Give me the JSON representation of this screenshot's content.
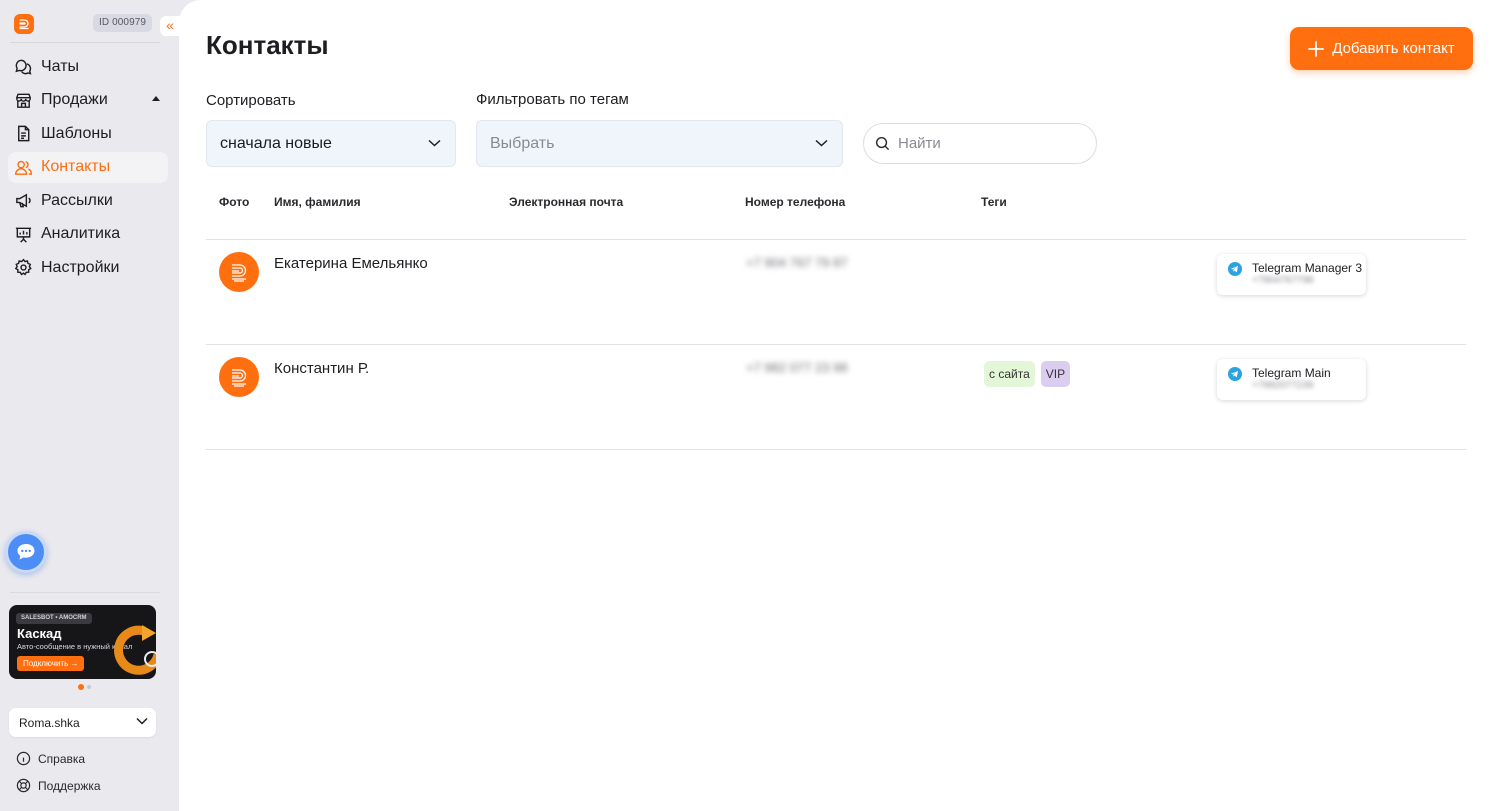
{
  "sidebar": {
    "account_id": "ID 000979",
    "collapse_glyph": "«",
    "nav": [
      {
        "label": "Чаты",
        "icon": "chats-icon"
      },
      {
        "label": "Продажи",
        "icon": "store-icon"
      },
      {
        "label": "Шаблоны",
        "icon": "template-icon"
      },
      {
        "label": "Контакты",
        "icon": "contacts-icon",
        "active": true
      },
      {
        "label": "Рассылки",
        "icon": "megaphone-icon"
      },
      {
        "label": "Аналитика",
        "icon": "analytics-icon"
      },
      {
        "label": "Настройки",
        "icon": "gear-icon"
      }
    ],
    "banner": {
      "tag": "SALESBOT • AMOCRM",
      "title": "Каскад",
      "subtitle": "Авто-сообщение в нужный канал",
      "button": "Подключить →"
    },
    "account_name": "Roma.shka",
    "help": "Справка",
    "support": "Поддержка"
  },
  "page": {
    "title": "Контакты",
    "add_button": "Добавить контакт",
    "sort_label": "Сортировать",
    "sort_value": "сначала новые",
    "filter_label": "Фильтровать по тегам",
    "filter_placeholder": "Выбрать",
    "search_placeholder": "Найти"
  },
  "table": {
    "headers": {
      "photo": "Фото",
      "name": "Имя, фамилия",
      "email": "Электронная почта",
      "phone": "Номер телефона",
      "tags": "Теги"
    },
    "rows": [
      {
        "name": "Екатерина Емельянко",
        "phone": "+7 904 767 79 87",
        "tags": [],
        "channel": "Telegram Manager 3",
        "channel_sub": "+7904767798"
      },
      {
        "name": "Константин Р.",
        "phone": "+7 982 077 23 98",
        "tags": [
          {
            "label": "с сайта",
            "color": "#e3f6d8"
          },
          {
            "label": "VIP",
            "color": "#dccdf0"
          }
        ],
        "channel": "Telegram Main",
        "channel_sub": "+7982077239"
      }
    ]
  },
  "colors": {
    "accent": "#ff6e0f",
    "chat_bubble": "#4c8df6",
    "telegram": "#2aa3e0"
  }
}
